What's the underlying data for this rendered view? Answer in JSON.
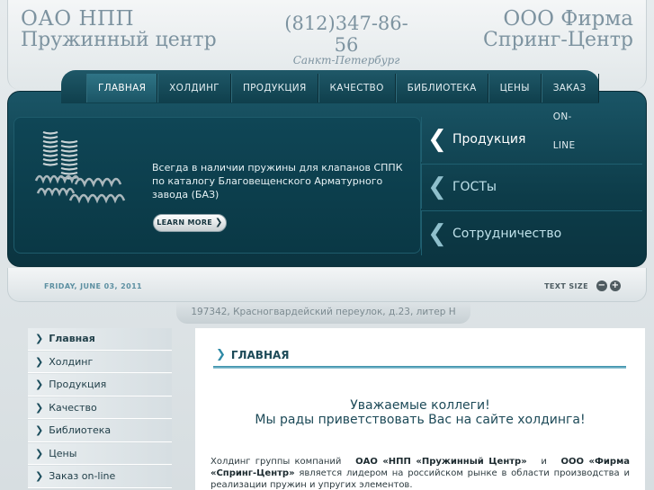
{
  "header": {
    "brand_left_line1": "ОАО НПП",
    "brand_left_line2": "Пружинный центр",
    "phone": "(812)347-86-56",
    "city": "Санкт-Петербург",
    "brand_right_line1": "ООО Фирма",
    "brand_right_line2": "Спринг-Центр"
  },
  "nav": {
    "items": [
      {
        "label": "ГЛАВНАЯ",
        "active": true
      },
      {
        "label": "ХОЛДИНГ"
      },
      {
        "label": "ПРОДУКЦИЯ"
      },
      {
        "label": "КАЧЕСТВО"
      },
      {
        "label": "БИБЛИОТЕКА"
      },
      {
        "label": "ЦЕНЫ"
      },
      {
        "label": "ЗАКАЗ ON-LINE"
      }
    ]
  },
  "banner": {
    "text": "Всегда в наличии пружины для клапанов СППК по каталогу Благовещенского Арматурного завода (БАЗ)",
    "button_label": "LEARN MORE",
    "right_menu": [
      {
        "label": "Продукция",
        "active": true
      },
      {
        "label": "ГОСТы"
      },
      {
        "label": "Сотрудничество"
      }
    ]
  },
  "datebar": {
    "date": "FRIDAY, JUNE 03, 2011",
    "text_size_label": "TEXT SIZE",
    "minus": "−",
    "plus": "+"
  },
  "address": "197342, Красногвардейский переулок, д.23, литер Н",
  "sidebar": {
    "items": [
      {
        "label": "Главная",
        "active": true
      },
      {
        "label": "Холдинг"
      },
      {
        "label": "Продукция"
      },
      {
        "label": "Качество"
      },
      {
        "label": "Библиотека"
      },
      {
        "label": "Цены"
      },
      {
        "label": "Заказ on-line"
      }
    ]
  },
  "content": {
    "title": "ГЛАВНАЯ",
    "greeting_line1": "Уважаемые коллеги!",
    "greeting_line2": "Мы рады приветствовать Вас на сайте холдинга!",
    "para_prefix": "Холдинг группы компаний",
    "company1": "ОАО «НПП «Пружинный Центр»",
    "para_and": "и",
    "company2": "ООО «Фирма «Спринг-Центр»",
    "para_rest": "является лидером на российском рынке в области производства и реализации пружин и упругих элементов."
  },
  "colors": {
    "nav_bg": "#0f3f4c",
    "banner_bg": "#0d3c49",
    "accent": "#2f8aa6",
    "brand_text": "#7d93a0"
  }
}
